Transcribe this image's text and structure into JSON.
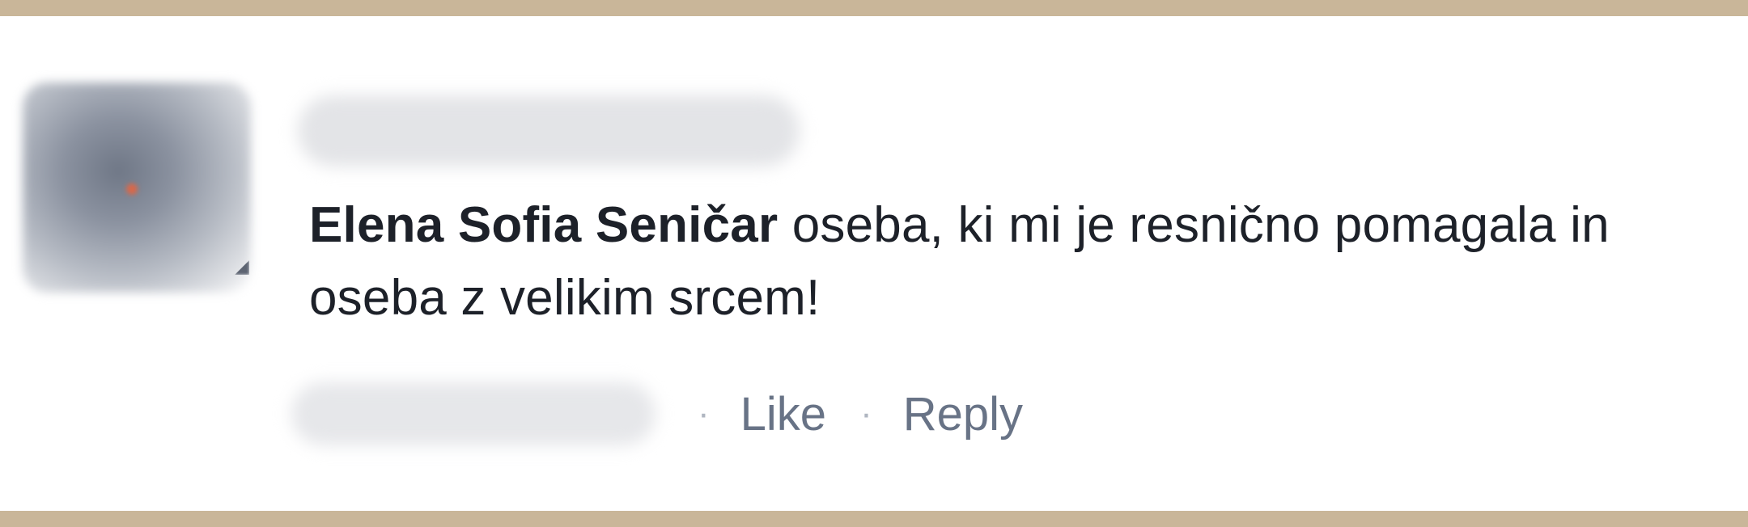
{
  "comment": {
    "author": "Elena Sofia Seničar",
    "text": " oseba, ki mi je resnično pomagala in oseba z velikim srcem!",
    "actions": {
      "separator": "·",
      "like_label": "Like",
      "reply_label": "Reply"
    }
  },
  "colors": {
    "frame_border": "#c9b699",
    "text": "#1d2129",
    "action_text": "#687386"
  }
}
